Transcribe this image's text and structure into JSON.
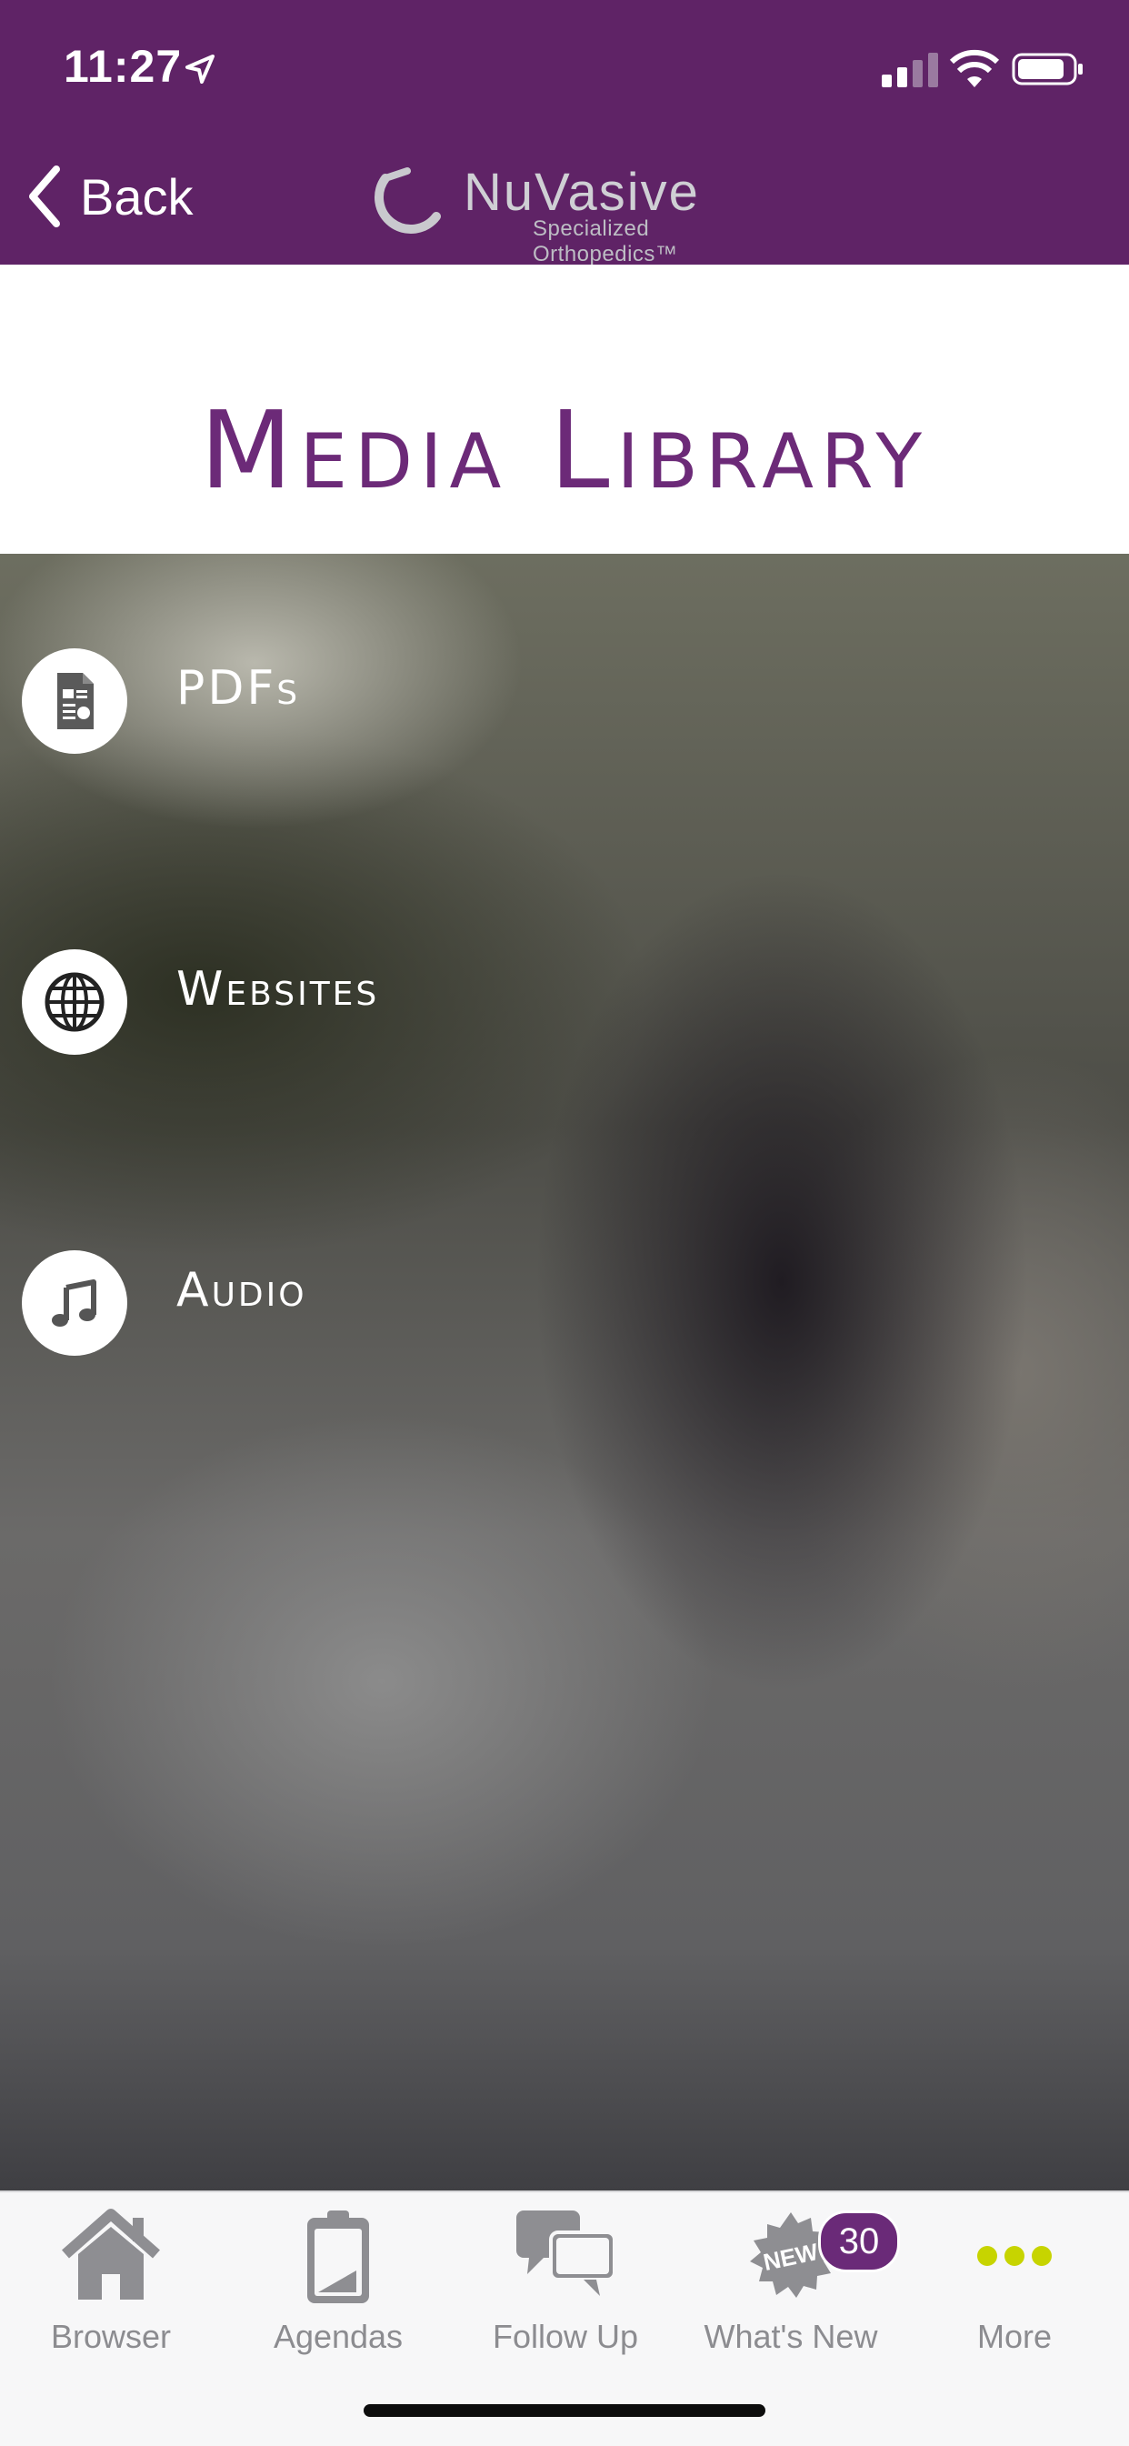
{
  "status": {
    "time": "11:27"
  },
  "nav": {
    "back_label": "Back",
    "logo_name": "NuVasive",
    "logo_tagline": "Specialized Orthopedics™"
  },
  "page": {
    "title": "Media Library"
  },
  "menu": [
    {
      "label": "PDFs",
      "icon": "document-icon"
    },
    {
      "label": "Websites",
      "icon": "globe-icon"
    },
    {
      "label": "Audio",
      "icon": "music-note-icon"
    }
  ],
  "tabs": [
    {
      "label": "Browser",
      "icon": "home-icon"
    },
    {
      "label": "Agendas",
      "icon": "clipboard-icon"
    },
    {
      "label": "Follow Up",
      "icon": "chat-bubbles-icon"
    },
    {
      "label": "What's New",
      "icon": "new-seal-icon",
      "badge": "30",
      "seal_text": "NEW"
    },
    {
      "label": "More",
      "icon": "more-dots-icon"
    }
  ],
  "colors": {
    "brand_purple": "#5f2366",
    "title_purple": "#6c2a78",
    "more_accent": "#c7d400"
  }
}
